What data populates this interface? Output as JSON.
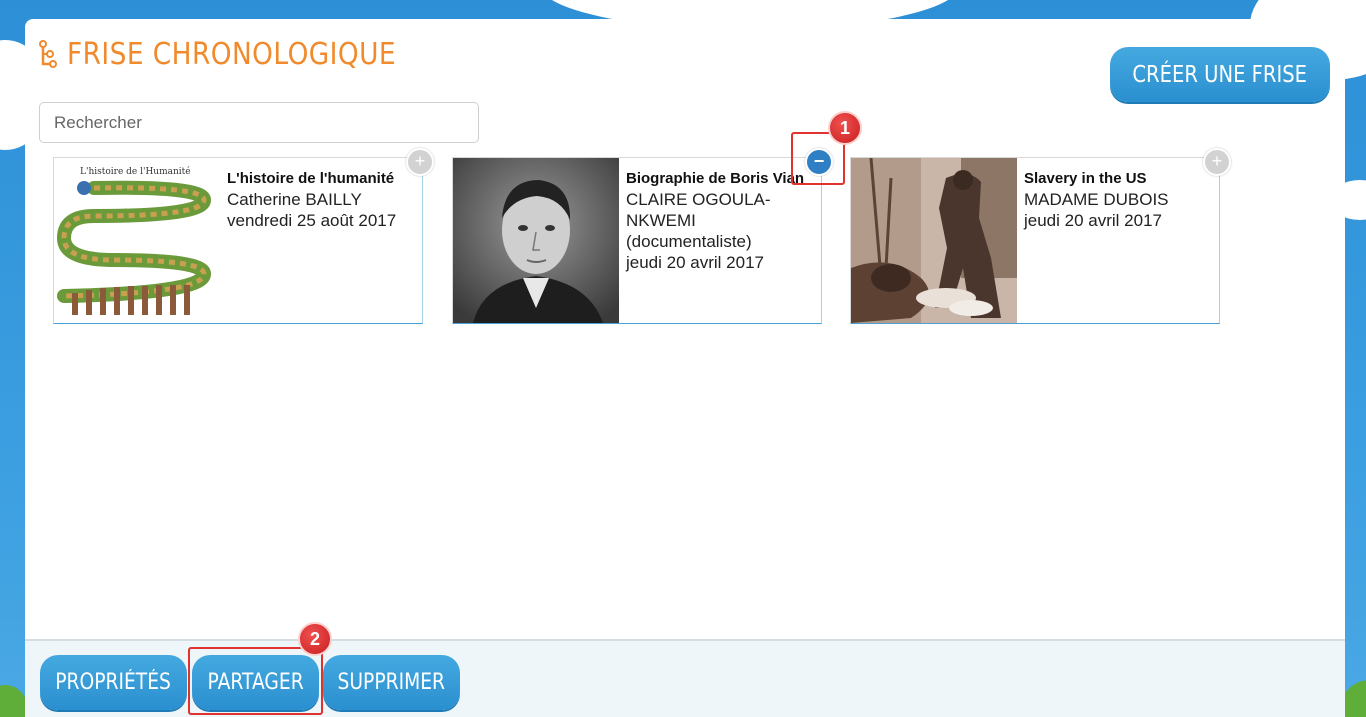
{
  "header": {
    "title": "FRISE CHRONOLOGIQUE",
    "create_button": "CRÉER UNE FRISE",
    "title_icon": "timeline-icon",
    "accent_color": "#f08a2c"
  },
  "search": {
    "placeholder": "Rechercher",
    "value": ""
  },
  "timelines": [
    {
      "title": "L'histoire de l'humanité",
      "author": "Catherine BAILLY",
      "date": "vendredi 25 août 2017",
      "thumb_title": "L'histoire de l'Humanité",
      "toggle": "+",
      "selected": false
    },
    {
      "title": "Biographie de Boris Vian",
      "author": "CLAIRE OGOULA-NKWEMI (documentaliste)",
      "date": "jeudi 20 avril 2017",
      "toggle": "−",
      "selected": true
    },
    {
      "title": "Slavery in the US",
      "author": "MADAME DUBOIS",
      "date": "jeudi 20 avril 2017",
      "toggle": "+",
      "selected": false
    }
  ],
  "annotations": {
    "badge1": "1",
    "badge2": "2",
    "color": "#e0322e"
  },
  "actions": {
    "properties": "PROPRIÉTÉS",
    "share": "PARTAGER",
    "delete": "SUPPRIMER"
  },
  "colors": {
    "button_blue": "#2a8fcf",
    "selected_toggle": "#2f7fc4"
  }
}
